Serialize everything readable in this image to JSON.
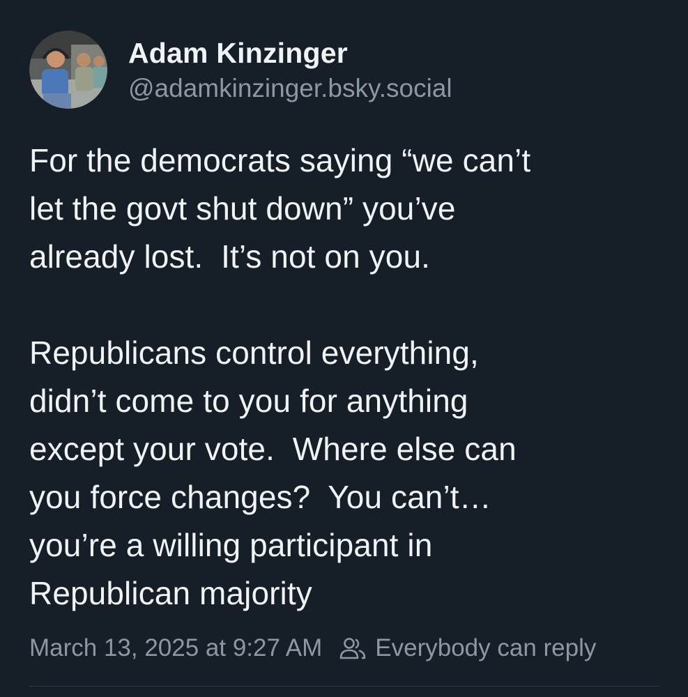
{
  "post": {
    "author": {
      "display_name": "Adam Kinzinger",
      "handle": "@adamkinzinger.bsky.social"
    },
    "text": "For the democrats saying “we can’t\nlet the govt shut down” you’ve\nalready lost.  It’s not on you.\n\nRepublicans control everything,\ndidn’t come to you for anything\nexcept your vote.  Where else can\nyou force changes?  You can’t…\nyou’re a willing participant in\nRepublican majority",
    "timestamp": "March 13, 2025 at 9:27 AM",
    "reply_setting": "Everybody can reply",
    "reply_icon": "people-icon"
  },
  "colors": {
    "background": "#161e27",
    "text": "#f1f3f5",
    "muted": "#8b98a5"
  }
}
